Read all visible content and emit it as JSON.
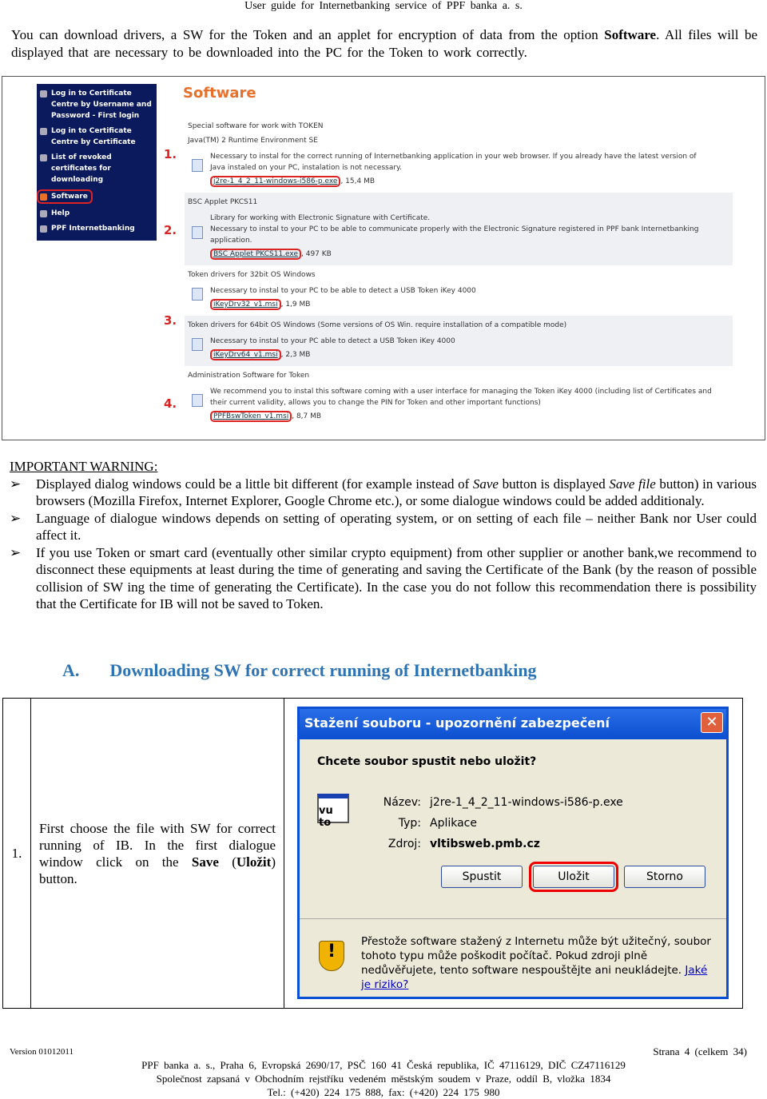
{
  "header": "User guide for Internetbanking service of PPF banka a. s.",
  "intro": {
    "text1": "You can download drivers, a SW for the Token and an applet for encryption of data from the option ",
    "bold": "Software",
    "text2": ". All files will be displayed that are necessary to be downloaded into the PC for the Token to work correctly."
  },
  "screenshot": {
    "sidebar": [
      "Log in to Certificate Centre by Username and Password - First login",
      "Log in to Certificate Centre by Certificate",
      "List of revoked certificates for downloading",
      "Software",
      "Help",
      "PPF Internetbanking"
    ],
    "title": "Software",
    "sections": [
      {
        "num": "1.",
        "heading": "Special software for work with TOKEN",
        "sub": "Java(TM) 2 Runtime Environment SE",
        "lines": [
          "Necessary to instal for the correct running of Internetbanking application in your web browser. If you already have the latest version of",
          "Java instaled on your PC, instalation is not necessary."
        ],
        "file": "j2re-1_4_2_11-windows-i586-p.exe",
        "size": ", 15,4 MB"
      },
      {
        "num": "2.",
        "heading": "BSC Applet PKCS11",
        "lines": [
          "Library for working with Electronic Signature with Certificate.",
          "Necessary to instal to your PC to be able to communicate properly with the Electronic Signature registered in PPF bank Internetbanking",
          "application."
        ],
        "file": "BSC Applet PKCS11.exe",
        "size": ", 497 KB"
      },
      {
        "num": "3.",
        "heading": "Token drivers for 32bit OS Windows",
        "lines": [
          "Necessary to instal to your PC to be able to detect a USB Token iKey 4000"
        ],
        "file": "iKeyDrv32_v1.msi",
        "size": ", 1,9 MB"
      },
      {
        "num": "",
        "heading": "Token drivers for 64bit OS Windows (Some versions of OS Win. require installation of a compatible mode)",
        "lines": [
          "Necessary to instal to your PC able to detect a USB Token iKey 4000"
        ],
        "file": "iKeyDrv64_v1.msi",
        "size": ", 2,3 MB"
      },
      {
        "num": "4.",
        "heading": "Administration Software for Token",
        "lines": [
          "We recommend you to instal this software coming with a user interface for managing the Token iKey 4000 (including list of Certificates and",
          "their current validity, allows you to change the PIN for Token and other important functions)"
        ],
        "file": "PPFBswToken_v1.msi",
        "size": ", 8,7 MB"
      }
    ]
  },
  "warning": {
    "title": "IMPORTANT WARNING:",
    "b1": {
      "t1": "Displayed dialog windows could be a little bit different (for example instead of ",
      "i1": "Save",
      "t2": " button is displayed ",
      "i2": "Save file",
      "t3": " button) in various browsers (Mozilla Firefox, Internet Explorer, Google Chrome etc.), or some dialogue windows could be added additionaly."
    },
    "b2": "Language of dialogue windows depends on setting of operating system, or on setting of each file – neither Bank nor User could affect it.",
    "b3": "If you use Token or smart card (eventually other similar crypto equipment) from other supplier or another bank,we recommend to disconnect these equipments at least during the time of generating and saving the Certificate of the Bank (by the reason of possible collision of SW ing the time of generating the Certificate). In the case you do not follow this recommendation there is possibility that the Certificate for IB will not be saved to Token."
  },
  "section": {
    "letter": "A.",
    "title": "Downloading SW for correct running of Internetbanking"
  },
  "step": {
    "num": "1.",
    "t1": "First choose the file with SW for correct running of IB. In the first dialogue window click on the ",
    "b1": "Save",
    "t2": " (",
    "b2": "Uložit",
    "t3": ") button."
  },
  "dialog": {
    "title": "Stažení souboru - upozornění zabezpečení",
    "question": "Chcete soubor spustit nebo uložit?",
    "icon_text": "vu to",
    "name_label": "Název:",
    "name": "j2re-1_4_2_11-windows-i586-p.exe",
    "type_label": "Typ:",
    "type": "Aplikace",
    "source_label": "Zdroj:",
    "source": "vltibsweb.pmb.cz",
    "run": "Spustit",
    "save": "Uložit",
    "cancel": "Storno",
    "warning": "Přestože software stažený z Internetu může být užitečný, soubor tohoto typu může poškodit počítač. Pokud zdroji plně nedůvěřujete, tento software nespouštějte ani neukládejte. ",
    "risk_link": "Jaké je riziko?"
  },
  "footer": {
    "version": "Version 01012011",
    "page": "Strana 4 (celkem 34)",
    "l1": "PPF banka a. s., Praha 6, Evropská 2690/17, PSČ 160 41 Česká republika, IČ 47116129, DIČ CZ47116129",
    "l2": "Společnost zapsaná v Obchodním rejstříku vedeném městským soudem v Praze, oddíl B, vložka 1834",
    "l3": "Tel.: (+420) 224 175 888, fax: (+420) 224 175 980"
  }
}
